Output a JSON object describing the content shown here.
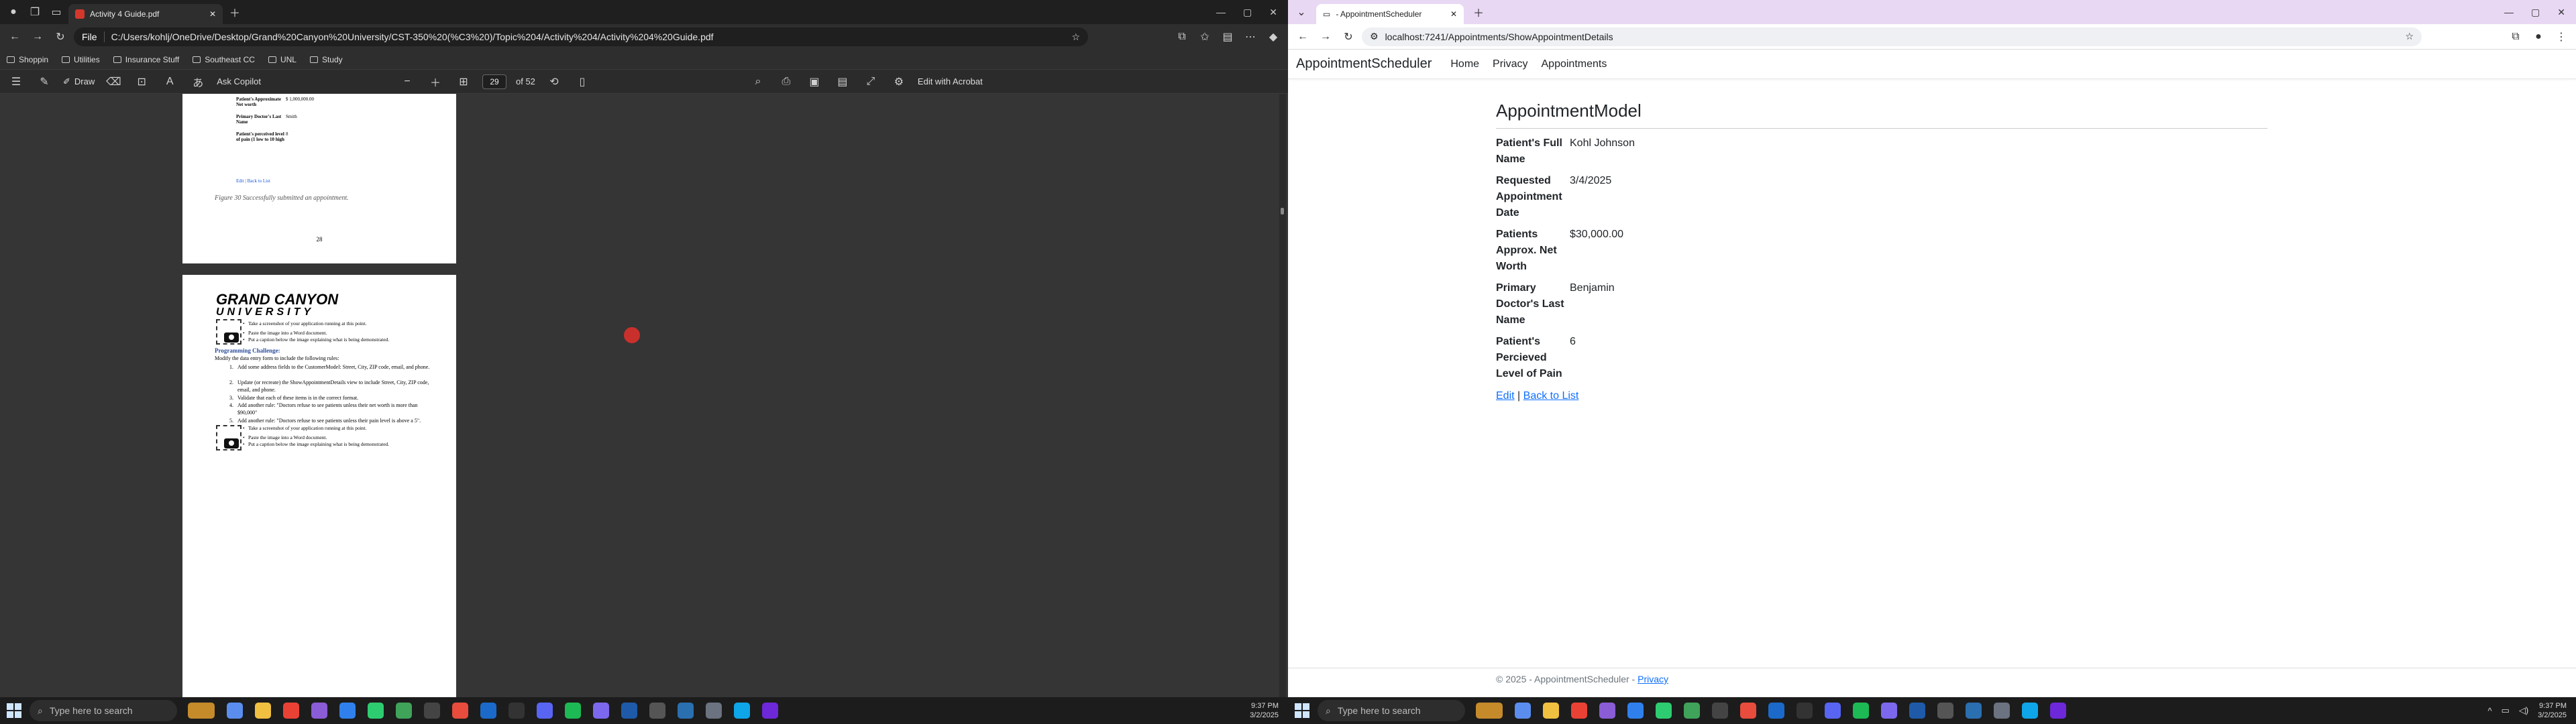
{
  "left": {
    "tab": {
      "title": "Activity 4 Guide.pdf"
    },
    "address": {
      "scheme": "File",
      "url": "C:/Users/kohlj/OneDrive/Desktop/Grand%20Canyon%20University/CST-350%20(%C3%20)/Topic%204/Activity%204/Activity%204%20Guide.pdf"
    },
    "bookmarks": [
      "Shoppin",
      "Utilities",
      "Insurance Stuff",
      "Southeast CC",
      "UNL",
      "Study"
    ],
    "pdfbar": {
      "draw": "Draw",
      "copilot": "Ask Copilot",
      "page": "29",
      "of": "of 52",
      "edit": "Edit with Acrobat"
    },
    "page1": {
      "rows": [
        {
          "label": "Patient's Approximate Net worth",
          "value": "$ 1,000,000.00"
        },
        {
          "label": "Primary Doctor's Last Name",
          "value": "Smith"
        },
        {
          "label": "Patient's perceived level of pain (1 low to 10 high",
          "value": "8"
        }
      ],
      "links": "Edit | Back to List",
      "caption": "Figure 30 Successfully submitted an appointment.",
      "page_number": "28"
    },
    "page2": {
      "logo1": "GRAND CANYON",
      "logo2": "UNIVERSITY",
      "bullets1": [
        "Take a screenshot of your application running at this point.",
        "Paste the image into a Word document.",
        "Put a caption below the image explaining what is being demonstrated."
      ],
      "challenge_title": "Programming Challenge:",
      "challenge_sub": "Modify the data entry form to include the following rules:",
      "items": [
        "Add some address fields to the CustomerModel: Street, City, ZIP code, email, and phone.",
        "Update (or recreate) the ShowAppointmentDetails view to include Street, City, ZIP code, email, and phone.",
        "Validate that each of these items is in the correct format.",
        "Add another rule: \"Doctors refuse to see patients unless their net worth is more than $90,000\"",
        "Add another rule: \"Doctors refuse to see patients unless their pain level is above a 5\"."
      ],
      "bullets2": [
        "Take a screenshot of your application running at this point.",
        "Paste the image into a Word document.",
        "Put a caption below the image explaining what is being demonstrated."
      ]
    }
  },
  "right": {
    "tab": {
      "title": "- AppointmentScheduler"
    },
    "address": {
      "url": "localhost:7241/Appointments/ShowAppointmentDetails"
    },
    "nav": {
      "brand": "AppointmentScheduler",
      "links": [
        "Home",
        "Privacy",
        "Appointments"
      ]
    },
    "heading": "AppointmentModel",
    "details": [
      {
        "label": "Patient's Full Name",
        "value": "Kohl Johnson"
      },
      {
        "label": "Requested Appointment Date",
        "value": "3/4/2025"
      },
      {
        "label": "Patients Approx. Net Worth",
        "value": "$30,000.00"
      },
      {
        "label": "Primary Doctor's Last Name",
        "value": "Benjamin"
      },
      {
        "label": "Patient's Percieved Level of Pain",
        "value": "6"
      }
    ],
    "links": {
      "edit": "Edit",
      "sep": "|",
      "back": "Back to List"
    },
    "footer": {
      "text": "© 2025 - AppointmentScheduler - ",
      "privacy": "Privacy"
    }
  },
  "taskbar": {
    "search": "Type here to search",
    "time": "9:37 PM",
    "date": "3/2/2025"
  },
  "colors": {
    "accent": "#0d6efd",
    "pdf_red": "#d4382c",
    "right_tabstrip": "#e9d8f4"
  }
}
